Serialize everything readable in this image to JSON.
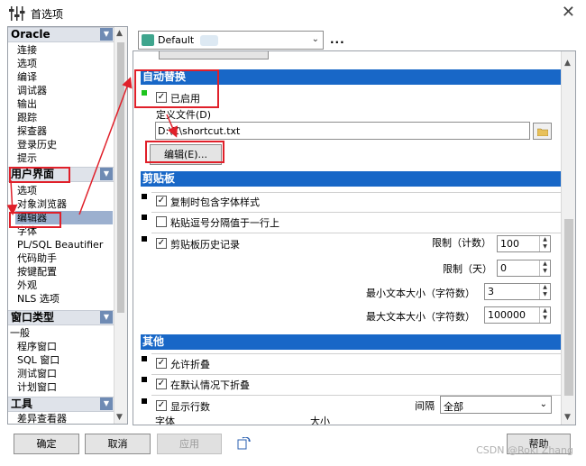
{
  "window": {
    "title": "首选项",
    "close_glyph": "✕"
  },
  "sidebar": {
    "groups": [
      {
        "label": "Oracle",
        "items": [
          "连接",
          "选项",
          "编译",
          "调试器",
          "输出",
          "跟踪",
          "探查器",
          "登录历史",
          "提示"
        ]
      },
      {
        "label": "用户界面",
        "items": [
          "选项",
          "对象浏览器",
          "编辑器",
          "字体",
          "PL/SQL Beautifier",
          "代码助手",
          "按键配置",
          "外观",
          "NLS 选项"
        ],
        "selected_item": "编辑器"
      },
      {
        "label": "窗口类型",
        "items": [
          "一般",
          "程序窗口",
          "SQL 窗口",
          "测试窗口",
          "计划窗口"
        ]
      },
      {
        "label": "工具",
        "items": [
          "差异查看器"
        ]
      }
    ]
  },
  "preset": {
    "value": "Default",
    "more": "..."
  },
  "sections": {
    "autoreplace": {
      "title": "自动替换",
      "enabled_label": "已启用",
      "enabled_checked": true,
      "file_label": "定义文件(D)",
      "file_value": "D:\\Z\\shortcut.txt",
      "edit_button": "编辑(E)..."
    },
    "clipboard": {
      "title": "剪贴板",
      "opt1_label": "复制时包含字体样式",
      "opt1_checked": true,
      "opt2_label": "粘贴逗号分隔值于一行上",
      "opt2_checked": false,
      "history_label": "剪贴板历史记录",
      "history_checked": true,
      "limit_count_label": "限制（计数）",
      "limit_count_value": "100",
      "limit_days_label": "限制（天）",
      "limit_days_value": "0",
      "min_size_label": "最小文本大小（字符数）",
      "min_size_value": "3",
      "max_size_label": "最大文本大小（字符数）",
      "max_size_value": "100000"
    },
    "other": {
      "title": "其他",
      "fold_label": "允许折叠",
      "fold_checked": true,
      "default_fold_label": "在默认情况下折叠",
      "default_fold_checked": true,
      "line_numbers_label": "显示行数",
      "line_numbers_checked": true,
      "interval_label": "间隔",
      "interval_value": "全部",
      "font_label": "字体",
      "size_label": "大小"
    }
  },
  "footer": {
    "ok": "确定",
    "cancel": "取消",
    "apply": "应用",
    "help": "帮助"
  },
  "watermark": "CSDN @Roki Zhang",
  "colors": {
    "section_header": "#1867c7",
    "selection": "#9cb0cf",
    "annotation": "#e0202a"
  }
}
